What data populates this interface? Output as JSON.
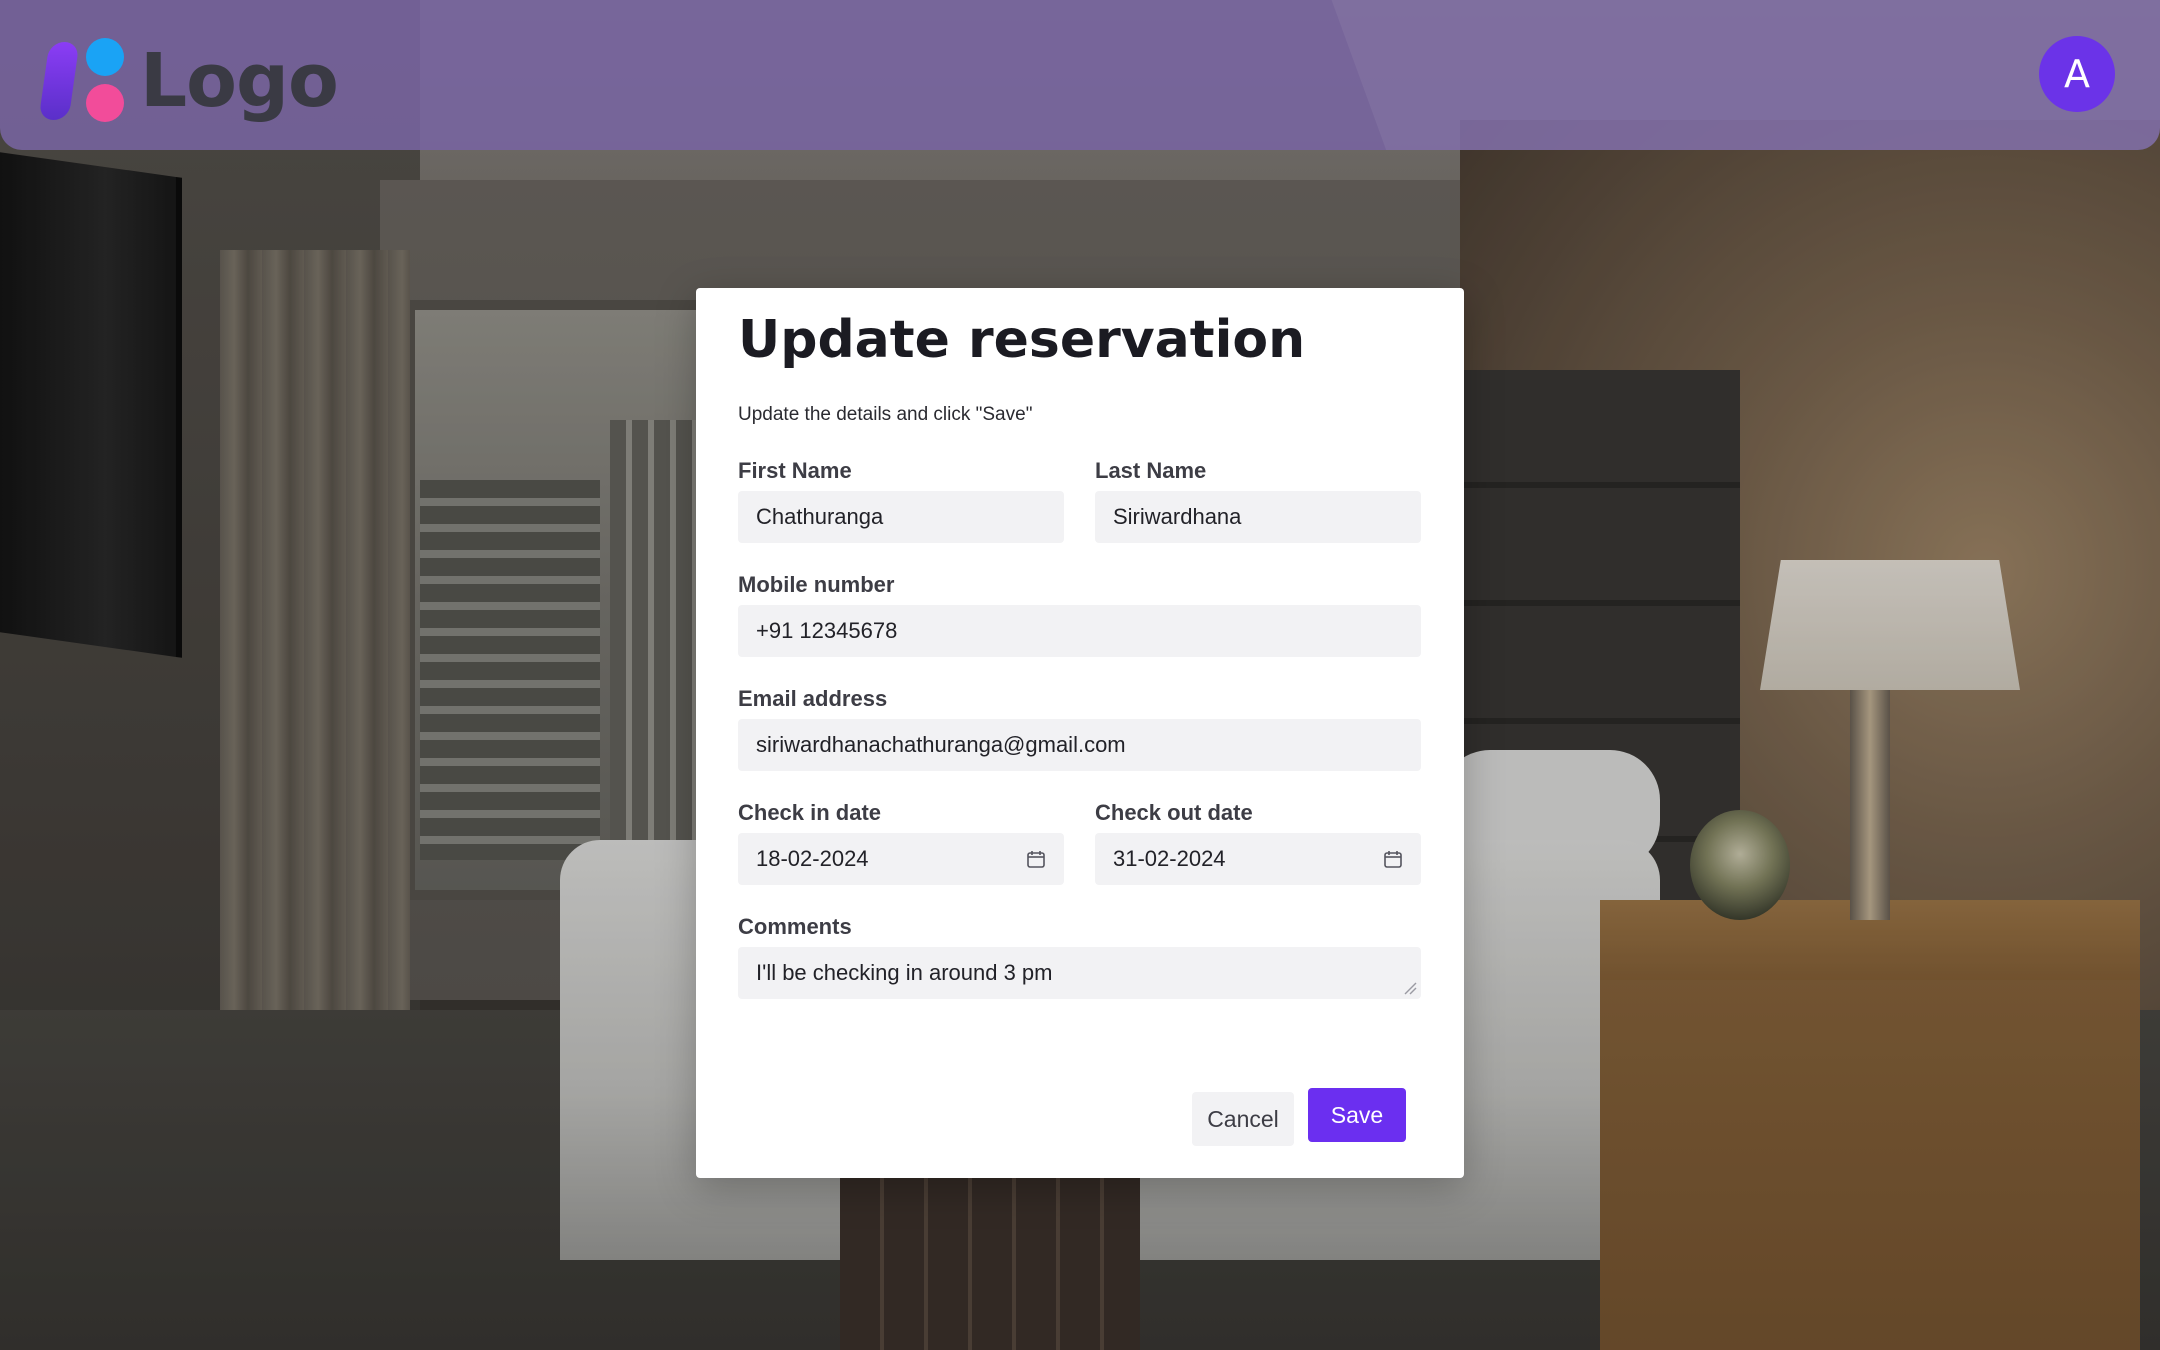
{
  "header": {
    "logo_text": "Logo",
    "avatar_initial": "A"
  },
  "modal": {
    "title": "Update reservation",
    "subtitle": "Update the details and click \"Save\"",
    "fields": {
      "first_name": {
        "label": "First Name",
        "value": "Chathuranga"
      },
      "last_name": {
        "label": "Last Name",
        "value": "Siriwardhana"
      },
      "mobile": {
        "label": "Mobile number",
        "value": "+91 12345678"
      },
      "email": {
        "label": "Email address",
        "value": "siriwardhanachathuranga@gmail.com"
      },
      "check_in": {
        "label": "Check in date",
        "value": "18-02-2024"
      },
      "check_out": {
        "label": "Check out date",
        "value": "31-02-2024"
      },
      "comments": {
        "label": "Comments",
        "value": "I'll be checking in around 3 pm"
      }
    },
    "buttons": {
      "cancel": "Cancel",
      "save": "Save"
    }
  },
  "colors": {
    "header_bg": "#7864a0",
    "accent": "#6b2ff0",
    "avatar_bg": "#6b33e8",
    "input_bg": "#f2f2f4"
  },
  "icons": {
    "calendar": "calendar-icon",
    "resize": "resize-handle-icon"
  }
}
